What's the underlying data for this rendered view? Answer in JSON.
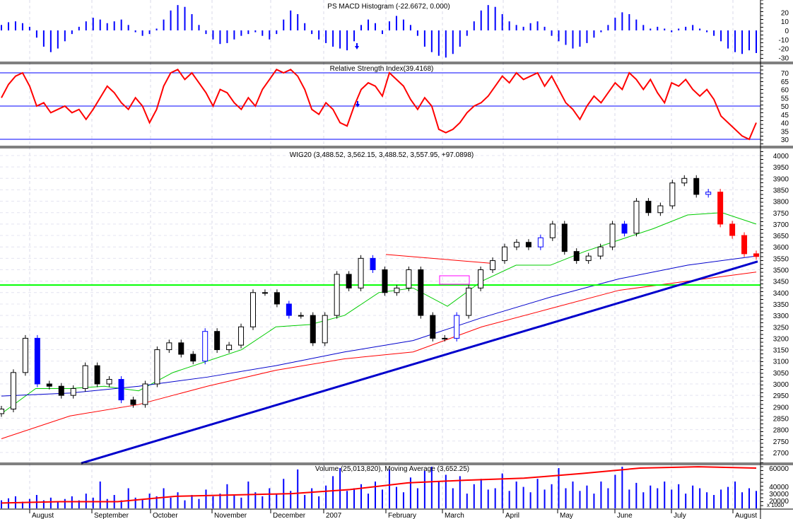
{
  "chart_data": [
    {
      "type": "bar",
      "title": "PS MACD Histogram (-22.6672, 0.000)",
      "yticks": [
        20,
        10,
        0,
        -10,
        -20,
        -30
      ],
      "ylim": [
        -33,
        33
      ],
      "values": [
        6,
        9,
        10,
        8,
        4,
        -8,
        -18,
        -24,
        -20,
        -12,
        -4,
        4,
        10,
        14,
        12,
        8,
        10,
        12,
        6,
        -2,
        -6,
        -4,
        2,
        12,
        22,
        28,
        26,
        18,
        6,
        -4,
        -10,
        -15,
        -14,
        -10,
        -6,
        -4,
        -2,
        -6,
        -10,
        -4,
        12,
        22,
        18,
        8,
        -4,
        -10,
        -14,
        -18,
        -20,
        -22,
        -12,
        6,
        12,
        8,
        -4,
        10,
        16,
        12,
        6,
        -6,
        -18,
        -24,
        -28,
        -30,
        -26,
        -18,
        -6,
        10,
        22,
        28,
        26,
        18,
        10,
        6,
        4,
        8,
        10,
        4,
        -6,
        -12,
        -16,
        -20,
        -18,
        -14,
        -8,
        -2,
        6,
        14,
        20,
        18,
        12,
        6,
        2,
        4,
        2,
        -2,
        2,
        4,
        6,
        2,
        -2,
        -6,
        -12,
        -20,
        -24,
        -26,
        -22,
        -25
      ],
      "color": "#0000ff"
    },
    {
      "type": "line",
      "title": "Relative Strength Index(39.4168)",
      "yticks": [
        70,
        65,
        60,
        55,
        50,
        45,
        40,
        35,
        30
      ],
      "reference_lines": [
        70,
        50,
        30
      ],
      "values": [
        55,
        63,
        68,
        70,
        62,
        50,
        52,
        46,
        48,
        50,
        46,
        48,
        42,
        48,
        55,
        62,
        58,
        52,
        48,
        55,
        50,
        40,
        48,
        62,
        70,
        72,
        66,
        70,
        64,
        58,
        50,
        60,
        58,
        52,
        48,
        55,
        50,
        60,
        66,
        72,
        70,
        72,
        68,
        60,
        48,
        45,
        52,
        48,
        40,
        38,
        50,
        60,
        64,
        62,
        56,
        70,
        66,
        62,
        54,
        48,
        55,
        50,
        36,
        34,
        36,
        40,
        46,
        50,
        52,
        56,
        62,
        68,
        64,
        70,
        66,
        68,
        70,
        62,
        68,
        60,
        52,
        48,
        42,
        50,
        56,
        52,
        58,
        64,
        60,
        70,
        66,
        60,
        66,
        58,
        52,
        64,
        62,
        66,
        60,
        56,
        60,
        54,
        44,
        40,
        36,
        32,
        30,
        40
      ],
      "color": "#ff0000"
    },
    {
      "type": "candlestick",
      "title": "WIG20 (3,488.52, 3,562.15, 3,488.52, 3,557.95, +97.0898)",
      "yticks": [
        4000,
        3950,
        3900,
        3850,
        3800,
        3750,
        3700,
        3650,
        3600,
        3550,
        3500,
        3450,
        3400,
        3350,
        3300,
        3250,
        3200,
        3150,
        3100,
        3050,
        3000,
        2950,
        2900,
        2850,
        2800,
        2750,
        2700
      ],
      "ylim": [
        2660,
        4030
      ],
      "closes": [
        2890,
        3050,
        3200,
        3000,
        2990,
        2950,
        2980,
        3080,
        3000,
        3020,
        2930,
        2910,
        3000,
        3150,
        3180,
        3130,
        3100,
        3230,
        3150,
        3170,
        3250,
        3400,
        3400,
        3350,
        3300,
        3300,
        3180,
        3300,
        3480,
        3420,
        3550,
        3500,
        3400,
        3420,
        3500,
        3300,
        3200,
        3200,
        3300,
        3420,
        3500,
        3540,
        3600,
        3620,
        3600,
        3640,
        3700,
        3580,
        3540,
        3560,
        3600,
        3700,
        3660,
        3800,
        3750,
        3780,
        3880,
        3900,
        3830,
        3840,
        3700,
        3650,
        3570,
        3558
      ],
      "moving_averages": [
        {
          "color": "#00cc00",
          "values": [
            2870,
            2980,
            2980,
            2990,
            2970,
            3050,
            3100,
            3150,
            3250,
            3260,
            3300,
            3400,
            3420,
            3340,
            3450,
            3520,
            3520,
            3580,
            3630,
            3680,
            3740,
            3750,
            3700
          ]
        },
        {
          "color": "#0000cc",
          "values": [
            2947,
            2960,
            2990,
            3030,
            3080,
            3140,
            3190,
            3290,
            3380,
            3460,
            3520,
            3560
          ]
        },
        {
          "color": "#ff0000",
          "values": [
            2760,
            2860,
            2910,
            2990,
            3060,
            3110,
            3140,
            3250,
            3330,
            3410,
            3450,
            3490
          ]
        }
      ],
      "trendline": {
        "from": 2653,
        "to": 3536,
        "color": "#0000cc"
      },
      "support_level": {
        "value": 3433,
        "color": "#00ff00"
      },
      "resistance_line": {
        "from": 3567,
        "to": 3527,
        "color": "#ff0000"
      }
    },
    {
      "type": "bar",
      "title": "Volume (25,013,820), Moving Average (3,652.25)",
      "yticks": [
        "60000",
        "40000",
        "30000",
        "20000"
      ],
      "unit_label": "x 1000",
      "values": [
        12,
        15,
        18,
        10,
        14,
        20,
        12,
        16,
        10,
        14,
        18,
        12,
        22,
        16,
        40,
        14,
        20,
        12,
        30,
        16,
        14,
        22,
        18,
        30,
        16,
        24,
        12,
        20,
        14,
        28,
        18,
        22,
        36,
        20,
        16,
        40,
        24,
        18,
        30,
        22,
        44,
        26,
        58,
        20,
        30,
        18,
        34,
        48,
        60,
        26,
        30,
        36,
        22,
        40,
        28,
        58,
        32,
        24,
        46,
        30,
        56,
        62,
        40,
        50,
        30,
        48,
        22,
        36,
        44,
        28,
        30,
        52,
        26,
        40,
        32,
        24,
        44,
        28,
        36,
        60,
        30,
        40,
        26,
        34,
        22,
        40,
        30,
        50,
        62,
        28,
        38,
        24,
        34,
        30,
        40,
        28,
        36,
        22,
        34,
        30,
        24,
        20,
        28,
        32,
        40,
        24,
        30,
        26
      ],
      "moving_average": [
        8,
        10,
        10,
        18,
        20,
        22,
        28,
        38,
        42,
        45,
        52,
        60,
        62,
        60
      ],
      "color": "#0000ff"
    }
  ],
  "x_axis": {
    "labels": [
      "August",
      "September",
      "October",
      "November",
      "December",
      "2007",
      "February",
      "March",
      "April",
      "May",
      "June",
      "July",
      "August"
    ]
  }
}
